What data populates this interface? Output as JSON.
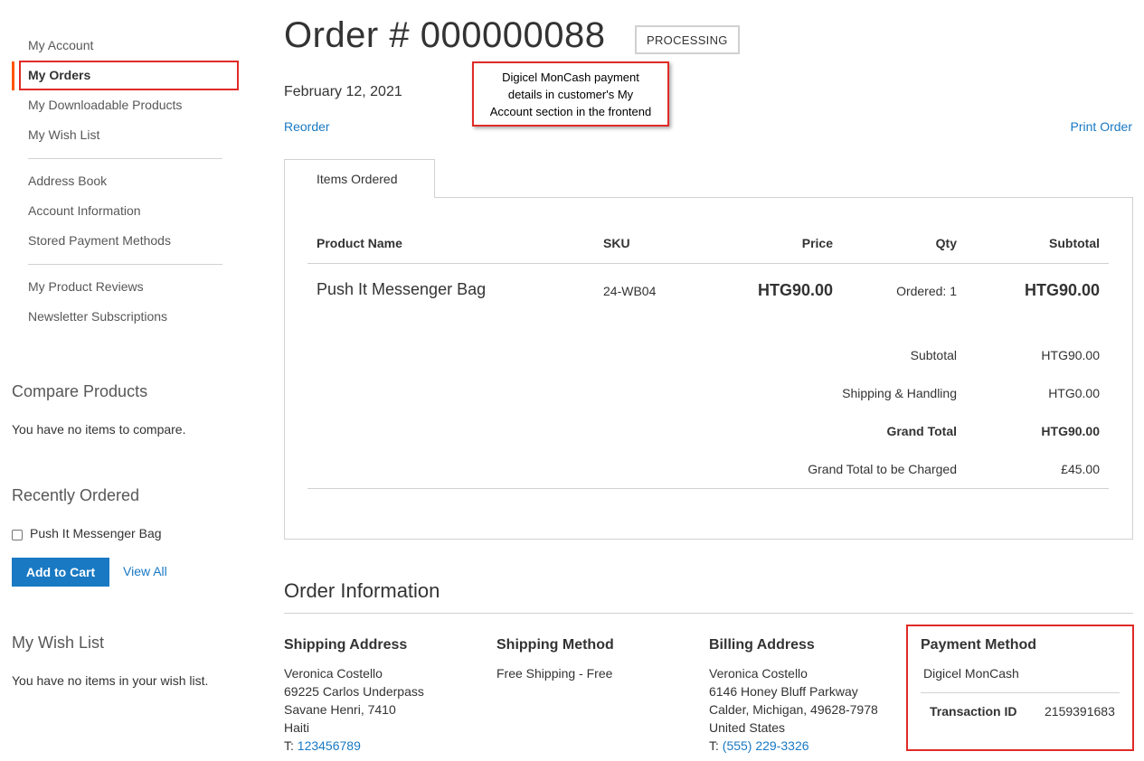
{
  "sidebar": {
    "nav_group_1": [
      "My Account",
      "My Orders",
      "My Downloadable Products",
      "My Wish List"
    ],
    "nav_group_2": [
      "Address Book",
      "Account Information",
      "Stored Payment Methods"
    ],
    "nav_group_3": [
      "My Product Reviews",
      "Newsletter Subscriptions"
    ],
    "compare": {
      "title": "Compare Products",
      "empty_text": "You have no items to compare."
    },
    "recently_ordered": {
      "title": "Recently Ordered",
      "item": "Push It Messenger Bag",
      "add_to_cart": "Add to Cart",
      "view_all": "View All"
    },
    "wishlist": {
      "title": "My Wish List",
      "empty_text": "You have no items in your wish list."
    },
    "accent_color": "#ff5501"
  },
  "order": {
    "title": "Order # 000000088",
    "status": "PROCESSING",
    "date": "February 12, 2021",
    "reorder": "Reorder",
    "print": "Print Order"
  },
  "callout": {
    "lines": [
      "Digicel MonCash payment",
      "details in customer's My",
      "Account section in the frontend"
    ],
    "border_color": "#e02b27"
  },
  "items": {
    "tab_label": "Items Ordered",
    "headers": {
      "product": "Product Name",
      "sku": "SKU",
      "price": "Price",
      "qty": "Qty",
      "subtotal": "Subtotal"
    },
    "rows": [
      {
        "name": "Push It Messenger Bag",
        "sku": "24-WB04",
        "price": "HTG90.00",
        "qty": "Ordered: 1",
        "subtotal": "HTG90.00"
      }
    ],
    "totals": [
      {
        "label": "Subtotal",
        "value": "HTG90.00"
      },
      {
        "label": "Shipping & Handling",
        "value": "HTG0.00"
      },
      {
        "label": "Grand Total",
        "value": "HTG90.00"
      },
      {
        "label": "Grand Total to be Charged",
        "value": "£45.00"
      }
    ]
  },
  "order_info": {
    "title": "Order Information",
    "shipping_address": {
      "title": "Shipping Address",
      "lines": [
        "Veronica Costello",
        "69225 Carlos Underpass",
        "Savane Henri, 7410",
        "Haiti"
      ],
      "phone_prefix": "T: ",
      "phone": "123456789"
    },
    "shipping_method": {
      "title": "Shipping Method",
      "value": "Free Shipping - Free"
    },
    "billing_address": {
      "title": "Billing Address",
      "lines": [
        "Veronica Costello",
        "6146 Honey Bluff Parkway",
        "Calder, Michigan, 49628-7978",
        "United States"
      ],
      "phone_prefix": "T: ",
      "phone": "(555) 229-3326"
    },
    "payment_method": {
      "title": "Payment Method",
      "name": "Digicel MonCash",
      "transaction_label": "Transaction ID",
      "transaction_id": "2159391683"
    }
  },
  "colors": {
    "link": "#1979c3",
    "button": "#1979c3",
    "highlight": "#e02b27"
  }
}
